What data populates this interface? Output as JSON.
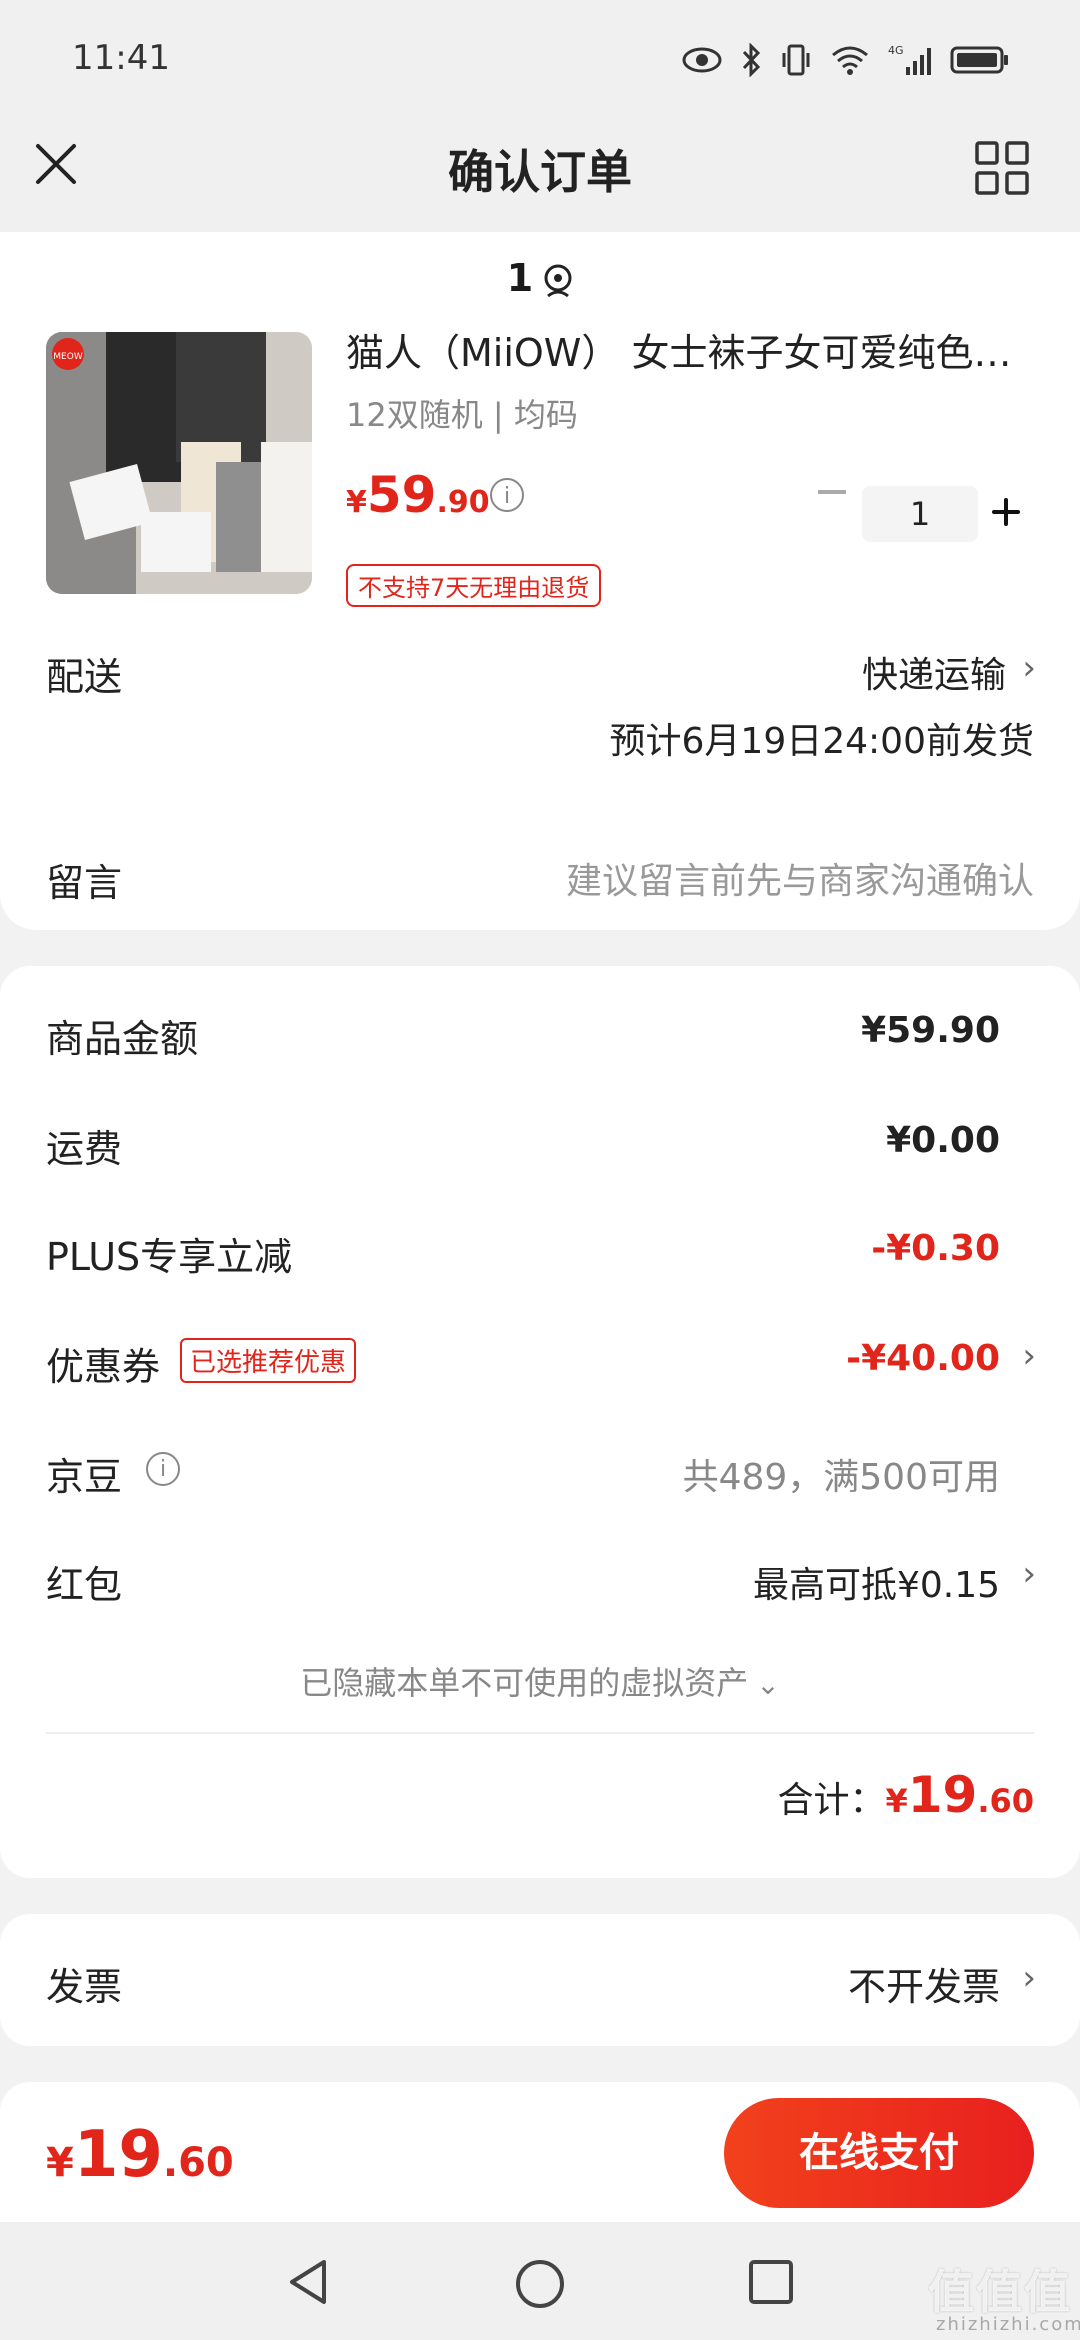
{
  "status_bar": {
    "time": "11:41"
  },
  "header": {
    "title": "确认订单"
  },
  "address": {
    "text": "1"
  },
  "product": {
    "title": "猫人（MiiOW） 女士袜子女可爱纯色…",
    "spec": "12双随机 | 均码",
    "price_currency": "¥",
    "price_int": "59",
    "price_dec": ".90",
    "quantity": "1",
    "return_badge": "不支持7天无理由退货",
    "brand_logo_text": "MEOW"
  },
  "delivery": {
    "label": "配送",
    "method": "快递运输",
    "estimate": "预计6月19日24:00前发货"
  },
  "message": {
    "label": "留言",
    "placeholder": "建议留言前先与商家沟通确认"
  },
  "summary": {
    "goods_label": "商品金额",
    "goods_value": "¥59.90",
    "shipping_label": "运费",
    "shipping_value": "¥0.00",
    "plus_label": "PLUS专享立减",
    "plus_value": "-¥0.30",
    "coupon_label": "优惠券",
    "coupon_tag": "已选推荐优惠",
    "coupon_value": "-¥40.00",
    "jd_label": "京豆",
    "jd_value": "共489，满500可用",
    "redpack_label": "红包",
    "redpack_value": "最高可抵¥0.15",
    "hidden_assets": "已隐藏本单不可使用的虚拟资产",
    "total_label": "合计：",
    "total_currency": "¥",
    "total_int": "19",
    "total_dec": ".60"
  },
  "invoice": {
    "label": "发票",
    "value": "不开发票"
  },
  "footer": {
    "currency": "¥",
    "int": "19",
    "dec": ".60",
    "pay_label": "在线支付"
  },
  "watermark": {
    "text": "值值值",
    "sub": "zhizhizhi.com"
  },
  "colors": {
    "accent": "#e1251b",
    "button": "#f0301f"
  }
}
